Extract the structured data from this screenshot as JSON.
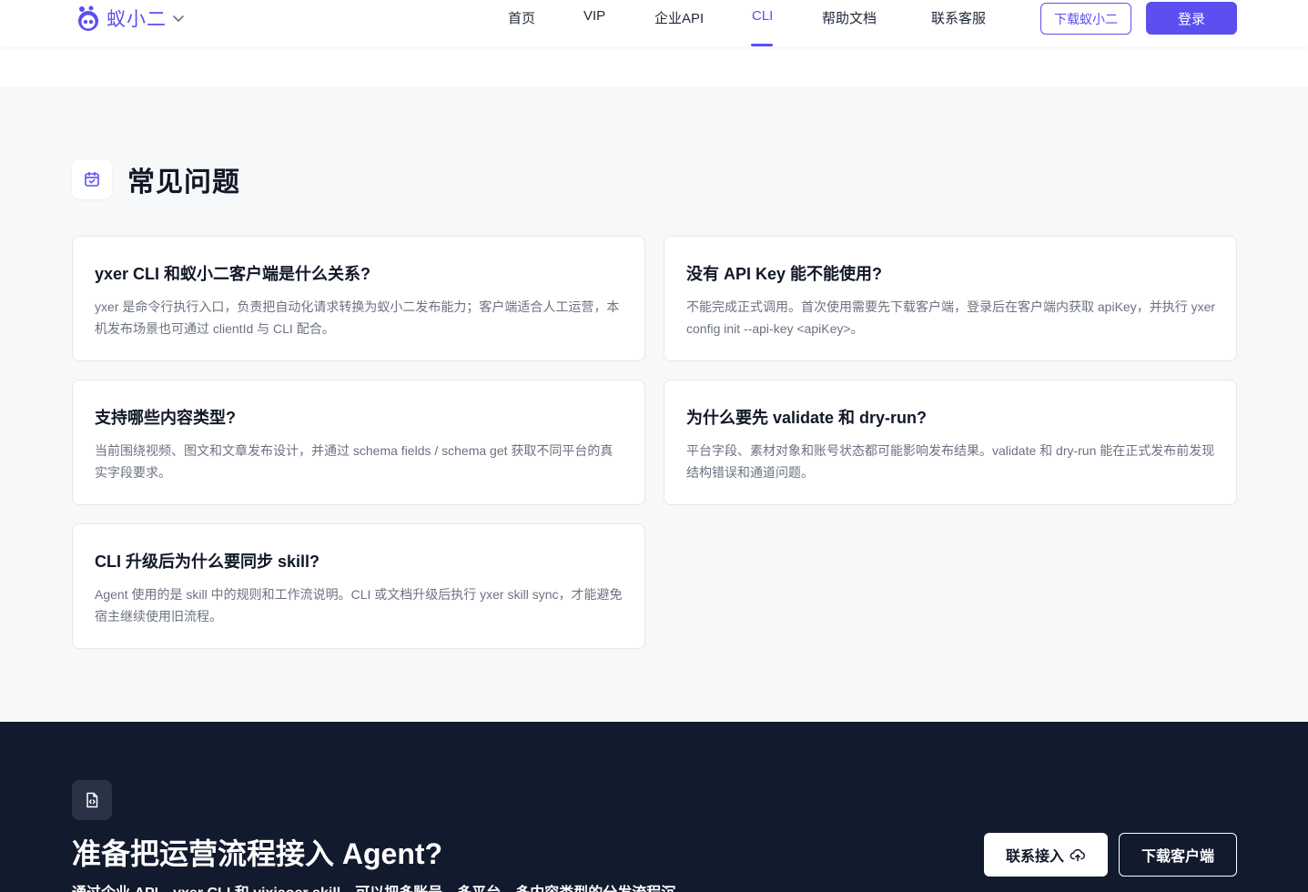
{
  "header": {
    "logo_text": "蚁小二",
    "nav": [
      {
        "label": "首页"
      },
      {
        "label": "VIP"
      },
      {
        "label": "企业API"
      },
      {
        "label": "CLI",
        "active": true
      },
      {
        "label": "帮助文档"
      },
      {
        "label": "联系客服"
      }
    ],
    "download_label": "下载蚁小二",
    "login_label": "登录"
  },
  "faq": {
    "title": "常见问题",
    "items": [
      {
        "question": "yxer CLI 和蚁小二客户端是什么关系?",
        "answer": "yxer 是命令行执行入口，负责把自动化请求转换为蚁小二发布能力；客户端适合人工运营，本机发布场景也可通过 clientId 与 CLI 配合。"
      },
      {
        "question": "没有 API Key 能不能使用?",
        "answer": "不能完成正式调用。首次使用需要先下载客户端，登录后在客户端内获取 apiKey，并执行 yxer config init --api-key <apiKey>。"
      },
      {
        "question": "支持哪些内容类型?",
        "answer": "当前围绕视频、图文和文章发布设计，并通过 schema fields / schema get 获取不同平台的真实字段要求。"
      },
      {
        "question": "为什么要先 validate 和 dry-run?",
        "answer": "平台字段、素材对象和账号状态都可能影响发布结果。validate 和 dry-run 能在正式发布前发现结构错误和通道问题。"
      },
      {
        "question": "CLI 升级后为什么要同步 skill?",
        "answer": "Agent 使用的是 skill 中的规则和工作流说明。CLI 或文档升级后执行 yxer skill sync，才能避免宿主继续使用旧流程。"
      }
    ]
  },
  "cta": {
    "title": "准备把运营流程接入 Agent?",
    "subtitle": "通过企业 API、yxer CLI 和 yixiaoer skill，可以把多账号、多平台、多内容类型的分发流程沉",
    "contact_label": "联系接入",
    "client_label": "下载客户端"
  },
  "colors": {
    "accent": "#5b4ff0",
    "faq_bg": "#f7f8fa",
    "cta_bg": "#121a2e"
  },
  "icons": {
    "logo": "ant-mascot-icon",
    "faq": "calendar-check-icon",
    "cta": "file-code-icon",
    "contact": "cloud-upload-icon"
  }
}
